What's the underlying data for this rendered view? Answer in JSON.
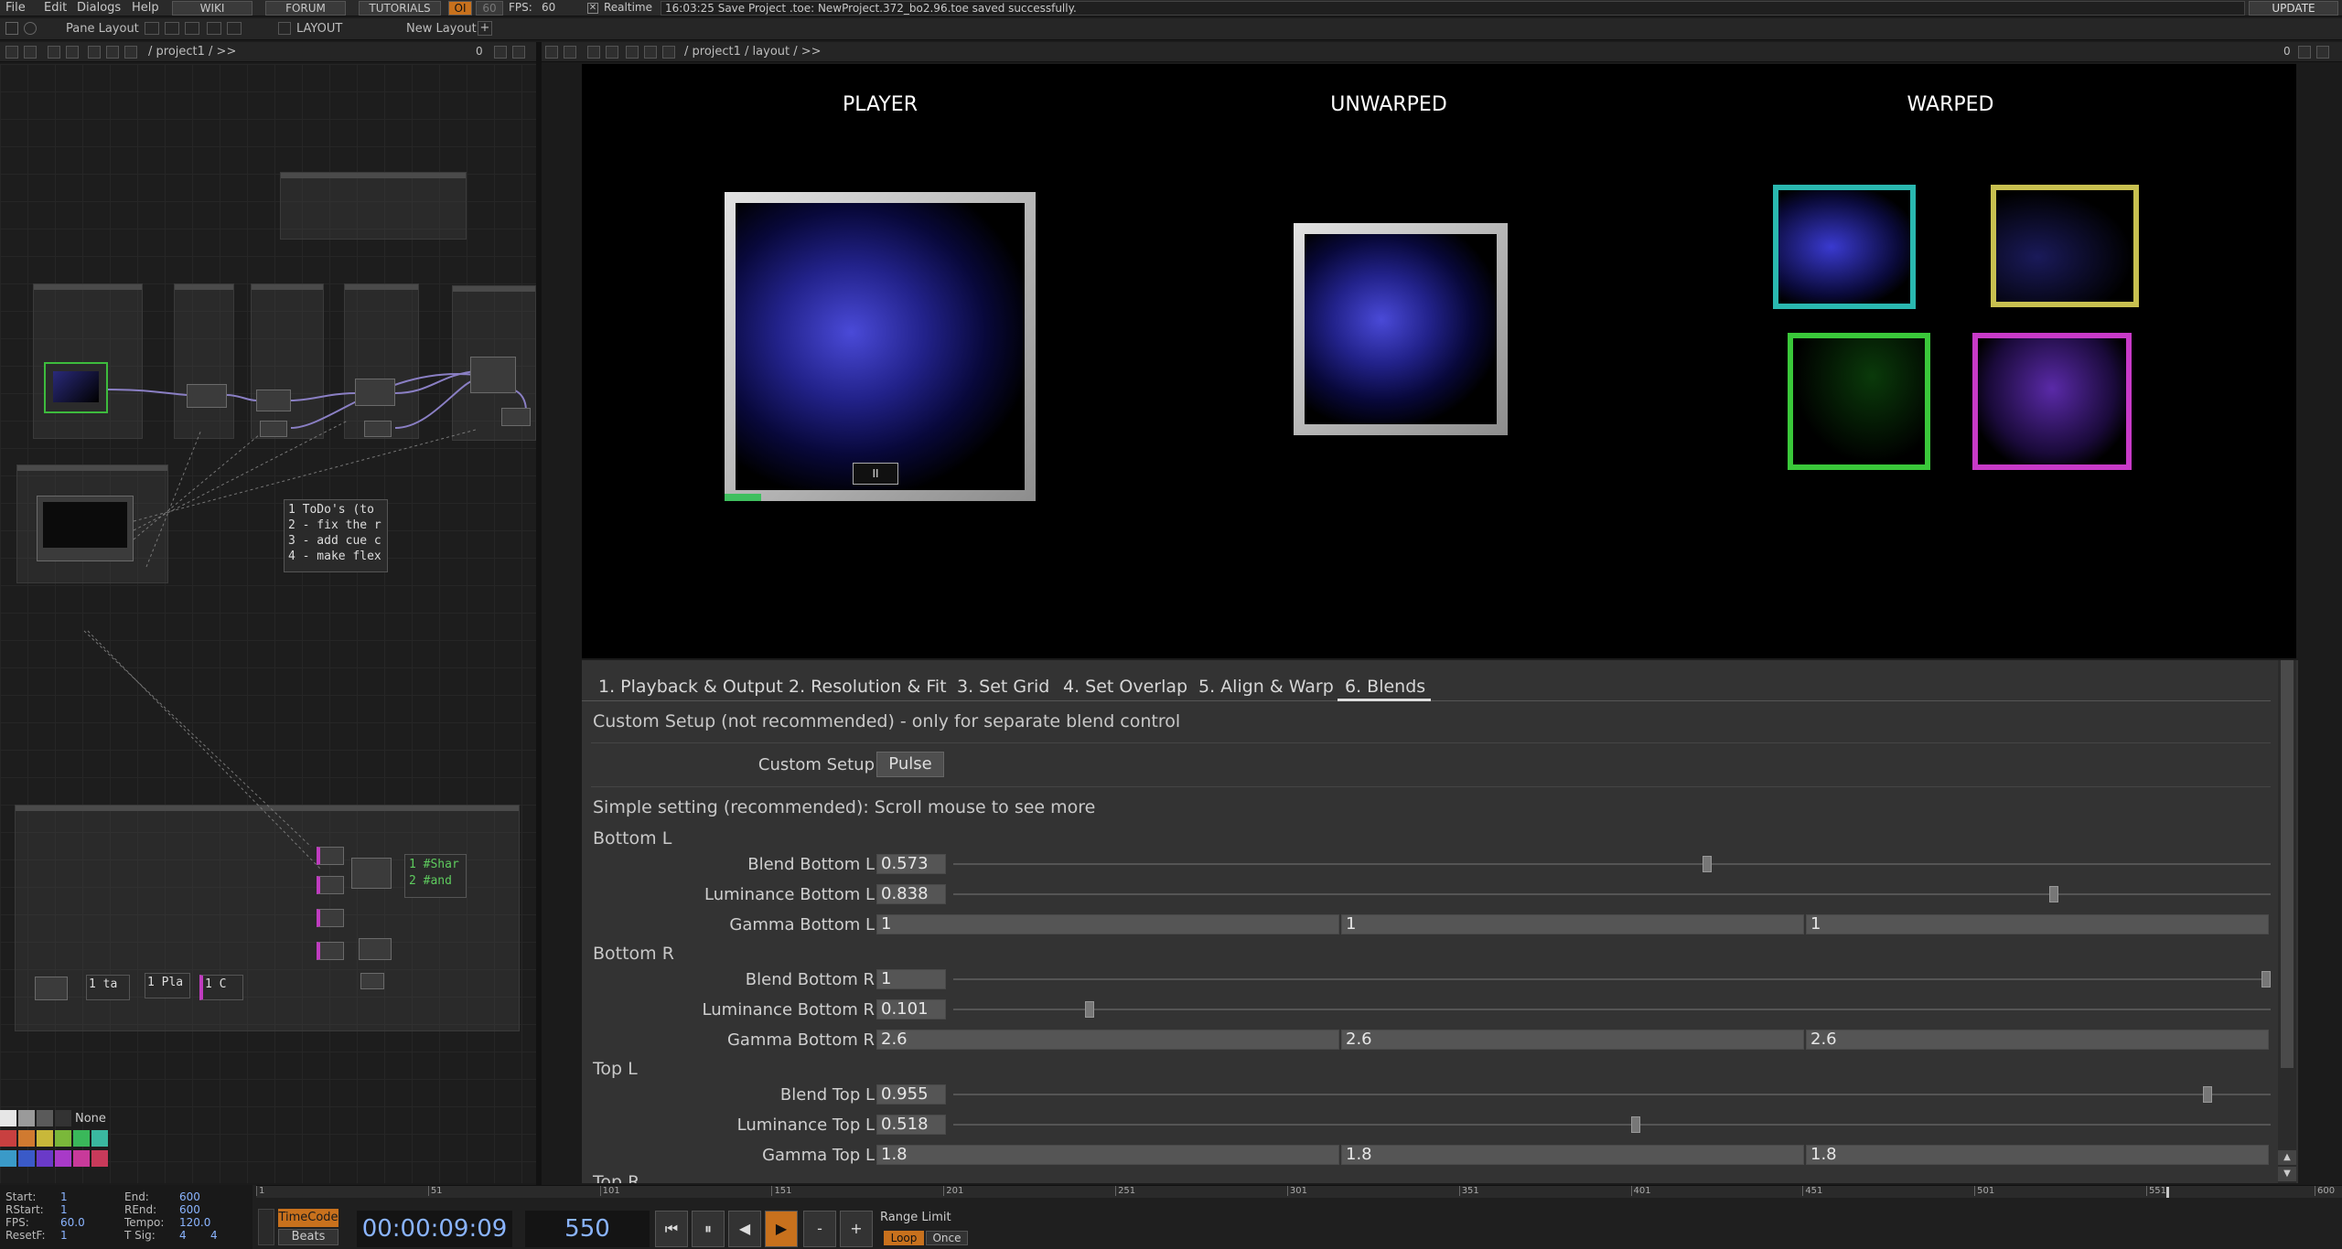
{
  "menubar": {
    "file": "File",
    "edit": "Edit",
    "dialogs": "Dialogs",
    "help": "Help",
    "wiki": "WIKI",
    "forum": "FORUM",
    "tutorials": "TUTORIALS",
    "oi": "OI",
    "fps_box": "60",
    "fps_label": "FPS:",
    "fps_value": "60",
    "realtime": "Realtime",
    "status": "16:03:25 Save Project .toe: NewProject.372_bo2.96.toe saved successfully.",
    "update": "UPDATE"
  },
  "toolbar": {
    "pane_layout": "Pane Layout",
    "layout": "LAYOUT",
    "new_layout": "New Layout",
    "plus": "+"
  },
  "left_path": {
    "path": "/ project1 / >>",
    "zero": "0"
  },
  "right_path": {
    "path": "/ project1 / layout / >>",
    "zero": "0"
  },
  "network": {
    "comment_lines": [
      "1 ToDo's (to",
      "2 - fix the r",
      "3 - add cue c",
      "4 - make flex"
    ],
    "mini_text": [
      "1 #Shar",
      "2 #and"
    ],
    "mini_nodes": [
      "1 ta",
      "1 Pla",
      "1 C"
    ],
    "none": "None"
  },
  "viewer": {
    "player": "PLAYER",
    "unwarped": "UNWARPED",
    "warped": "WARPED",
    "pause": "II"
  },
  "tabs": [
    "1. Playback & Output",
    "2. Resolution & Fit",
    "3. Set Grid",
    "4. Set Overlap",
    "5. Align & Warp",
    "6. Blends"
  ],
  "panel": {
    "custom_setup_header": "Custom Setup (not recommended) - only for separate blend control",
    "custom_setup_label": "Custom Setup",
    "pulse": "Pulse",
    "simple_setting": "Simple setting (recommended): Scroll mouse to see more",
    "groups": [
      {
        "title": "Bottom L",
        "blend_label": "Blend Bottom L",
        "blend": "0.573",
        "blend_frac": 0.573,
        "lum_label": "Luminance Bottom L",
        "lum": "0.838",
        "lum_frac": 0.838,
        "gamma_label": "Gamma Bottom L",
        "gamma": [
          "1",
          "1",
          "1"
        ]
      },
      {
        "title": "Bottom R",
        "blend_label": "Blend Bottom R",
        "blend": "1",
        "blend_frac": 1,
        "lum_label": "Luminance Bottom R",
        "lum": "0.101",
        "lum_frac": 0.101,
        "gamma_label": "Gamma Bottom R",
        "gamma": [
          "2.6",
          "2.6",
          "2.6"
        ]
      },
      {
        "title": "Top L",
        "blend_label": "Blend Top L",
        "blend": "0.955",
        "blend_frac": 0.955,
        "lum_label": "Luminance Top L",
        "lum": "0.518",
        "lum_frac": 0.518,
        "gamma_label": "Gamma Top L",
        "gamma": [
          "1.8",
          "1.8",
          "1.8"
        ]
      }
    ],
    "next_group": "Top R"
  },
  "timeline": {
    "ticks": [
      "1",
      "51",
      "101",
      "151",
      "201",
      "251",
      "301",
      "351",
      "401",
      "451",
      "501",
      "551",
      "600"
    ]
  },
  "info": {
    "start_l": "Start:",
    "start": "1",
    "end_l": "End:",
    "end": "600",
    "rstart_l": "RStart:",
    "rstart": "1",
    "rend_l": "REnd:",
    "rend": "600",
    "fps_l": "FPS:",
    "fps": "60.0",
    "tempo_l": "Tempo:",
    "tempo": "120.0",
    "resetf_l": "ResetF:",
    "resetf": "1",
    "tsig_l": "T Sig:",
    "tsig1": "4",
    "tsig2": "4"
  },
  "transport": {
    "timecode_btn": "TimeCode",
    "beats_btn": "Beats",
    "timecode": "00:00:09:09",
    "frame": "550",
    "range_limit": "Range Limit",
    "loop": "Loop",
    "once": "Once",
    "minus": "-",
    "plus": "+"
  }
}
